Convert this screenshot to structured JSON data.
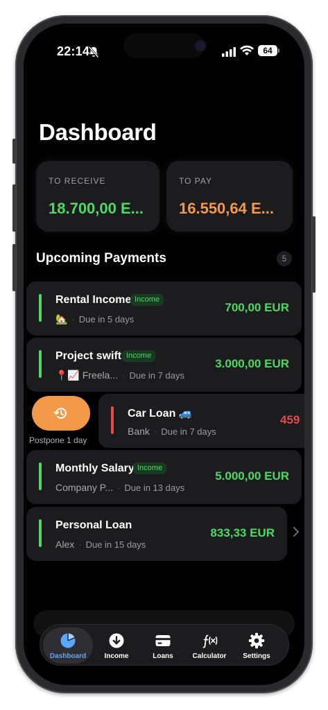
{
  "status": {
    "time": "22:14",
    "battery": "64"
  },
  "page": {
    "title": "Dashboard"
  },
  "summary": {
    "receive": {
      "label": "TO RECEIVE",
      "amount": "18.700,00 E...",
      "color": "#4cd964"
    },
    "pay": {
      "label": "TO PAY",
      "amount": "16.550,64 E...",
      "color": "#f2994a"
    }
  },
  "upcoming": {
    "title": "Upcoming Payments",
    "count": "5",
    "items": [
      {
        "title": "Rental Income",
        "badge": "Income",
        "who": "🏡",
        "due": "Due in 5 days",
        "amount": "700,00 EUR"
      },
      {
        "title": "Project swift",
        "badge": "Income",
        "who": "📍📈 Freela...",
        "due": "Due in 7 days",
        "amount": "3.000,00 EUR"
      },
      {
        "title": "Car Loan 🚙",
        "who": "Bank",
        "due": "Due in 7 days",
        "amount": "459"
      },
      {
        "title": "Monthly Salary",
        "badge": "Income",
        "who": "Company P...",
        "due": "Due in 13 days",
        "amount": "5.000,00 EUR"
      },
      {
        "title": "Personal Loan",
        "who": "Alex",
        "due": "Due in 15 days",
        "amount": "833,33 EUR"
      }
    ],
    "postpone_label": "Postpone 1 day"
  },
  "tabs": [
    {
      "label": "Dashboard",
      "icon": "pie-chart-icon",
      "active": true
    },
    {
      "label": "Income",
      "icon": "arrow-down-circle-icon"
    },
    {
      "label": "Loans",
      "icon": "credit-card-icon"
    },
    {
      "label": "Calculator",
      "icon": "function-icon"
    },
    {
      "label": "Settings",
      "icon": "gear-icon"
    }
  ],
  "colors": {
    "income": "#4cd964",
    "expense": "#e5484d",
    "accent": "#5aa7ff",
    "postpone": "#f2994a"
  }
}
